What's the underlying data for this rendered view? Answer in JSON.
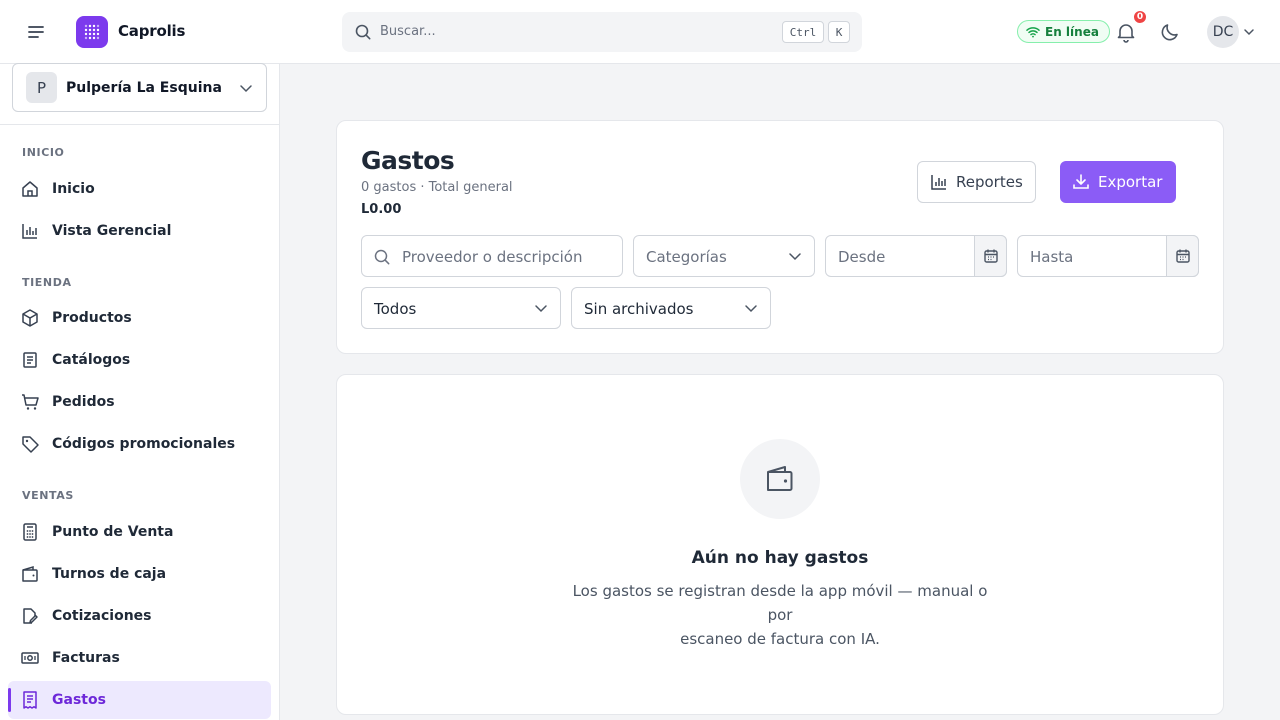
{
  "app": {
    "brand": "Caprolis"
  },
  "search": {
    "placeholder": "Buscar...",
    "shortcut_mod": "Ctrl",
    "shortcut_key": "K"
  },
  "header": {
    "status": "En línea",
    "notifications": "0",
    "user_initials": "DC"
  },
  "store": {
    "letter": "P",
    "name": "Pulpería La Esquina"
  },
  "sidebar": {
    "sections": [
      {
        "label": "INICIO",
        "items": [
          "Inicio",
          "Vista Gerencial"
        ]
      },
      {
        "label": "TIENDA",
        "items": [
          "Productos",
          "Catálogos",
          "Pedidos",
          "Códigos promocionales"
        ]
      },
      {
        "label": "VENTAS",
        "items": [
          "Punto de Venta",
          "Turnos de caja",
          "Cotizaciones",
          "Facturas",
          "Gastos"
        ]
      }
    ],
    "active": "Gastos"
  },
  "page": {
    "title": "Gastos",
    "subtitle": "0 gastos · Total general",
    "total": "L0.00",
    "reports_label": "Reportes",
    "export_label": "Exportar"
  },
  "filters": {
    "search_placeholder": "Proveedor o descripción",
    "category_placeholder": "Categorías",
    "from_placeholder": "Desde",
    "to_placeholder": "Hasta",
    "status_value": "Todos",
    "archive_value": "Sin archivados"
  },
  "empty": {
    "title": "Aún no hay gastos",
    "line1": "Los gastos se registran desde la app móvil — manual o por",
    "line2": "escaneo de factura con IA."
  },
  "colors": {
    "accent": "#7c3aed",
    "accent_light": "#ede9fe",
    "online": "#15803d",
    "alert": "#ef4444"
  }
}
